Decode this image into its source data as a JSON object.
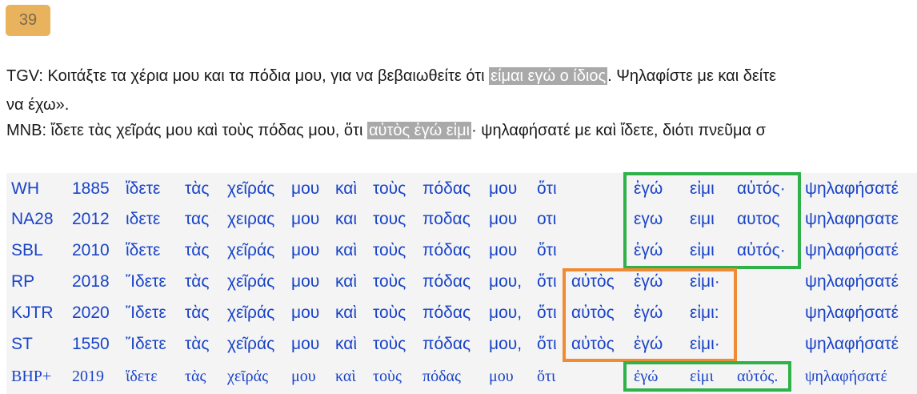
{
  "badge": "39",
  "tgv": {
    "label": "TGV:",
    "before": " Κοιτάξτε τα χέρια μου και τα πόδια μου, για να βεβαιωθείτε ότι ",
    "highlight": "είμαι εγώ ο ίδιος",
    "after": ". Ψηλαφίστε με και δείτε",
    "line2": "να έχω»."
  },
  "mnb": {
    "label": "MNB:",
    "before": " ἴδετε τὰς χεῖράς μου καὶ τοὺς πόδας μου, ὅτι ",
    "highlight": "αὐτὸς ἐγώ εἰμι",
    "after": "· ψηλαφήσατέ με καὶ ἴδετε, διότι πνεῦμα σ"
  },
  "rows": [
    {
      "source": "WH",
      "year": "1885",
      "w": [
        "ἴδετε",
        "τὰς",
        "χεῖράς",
        "μου",
        "καὶ",
        "τοὺς",
        "πόδας",
        "μου",
        "ὅτι",
        "",
        "ἐγώ",
        "εἰμι",
        "αὐτός·",
        "ψηλαφήσατέ"
      ]
    },
    {
      "source": "NA28",
      "year": "2012",
      "w": [
        "ιδετε",
        "τας",
        "χειρας",
        "μου",
        "και",
        "τους",
        "ποδας",
        "μου",
        "οτι",
        "",
        "εγω",
        "ειμι",
        "αυτος",
        "ψηλαφησατε"
      ]
    },
    {
      "source": "SBL",
      "year": "2010",
      "w": [
        "ἴδετε",
        "τὰς",
        "χεῖράς",
        "μου",
        "καὶ",
        "τοὺς",
        "πόδας",
        "μου",
        "ὅτι",
        "",
        "ἐγώ",
        "εἰμι",
        "αὐτός·",
        "ψηλαφήσατέ"
      ]
    },
    {
      "source": "RP",
      "year": "2018",
      "w": [
        "Ἴδετε",
        "τὰς",
        "χεῖράς",
        "μου",
        "καὶ",
        "τοὺς",
        "πόδας",
        "μου,",
        "ὅτι",
        "αὐτὸς",
        "ἐγώ",
        "εἰμι·",
        "",
        "ψηλαφήσατέ"
      ]
    },
    {
      "source": "KJTR",
      "year": "2020",
      "w": [
        "Ἴδετε",
        "τὰς",
        "χεῖράς",
        "μου",
        "καὶ",
        "τοὺς",
        "πόδας",
        "μου,",
        "ὅτι",
        "αὐτὸς",
        "ἐγώ",
        "εἰμι:",
        "",
        "ψηλαφήσατέ"
      ]
    },
    {
      "source": "ST",
      "year": "1550",
      "w": [
        "Ἴδετε",
        "τὰς",
        "χεῖράς",
        "μου",
        "καὶ",
        "τοὺς",
        "πόδας",
        "μου,",
        "ὅτι",
        "αὐτὸς",
        "ἐγώ",
        "εἰμι·",
        "",
        "ψηλαφήσατέ"
      ]
    },
    {
      "source": "BHP+",
      "year": "2019",
      "w": [
        "ἴδετε",
        "τὰς",
        "χεῖράς",
        "μου",
        "καὶ",
        "τοὺς",
        "πόδας",
        "μου",
        "ὅτι",
        "",
        "ἐγώ",
        "εἰμι",
        "αὐτός.",
        "ψηλαφήσατέ"
      ]
    }
  ]
}
